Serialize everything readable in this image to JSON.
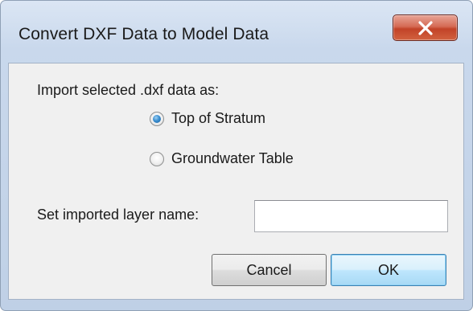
{
  "window": {
    "title": "Convert DXF Data to Model Data",
    "close_icon": "close-x-icon"
  },
  "import_section": {
    "label": "Import selected .dxf data as:",
    "options": [
      {
        "label": "Top of Stratum",
        "selected": true
      },
      {
        "label": "Groundwater Table",
        "selected": false
      }
    ]
  },
  "layer_name": {
    "label": "Set imported layer name:",
    "value": "",
    "placeholder": ""
  },
  "buttons": {
    "cancel_label": "Cancel",
    "ok_label": "OK"
  },
  "colors": {
    "close_button": "#c24328",
    "radio_selected": "#3b8fd0",
    "ok_button_border": "#3c7fb1"
  }
}
